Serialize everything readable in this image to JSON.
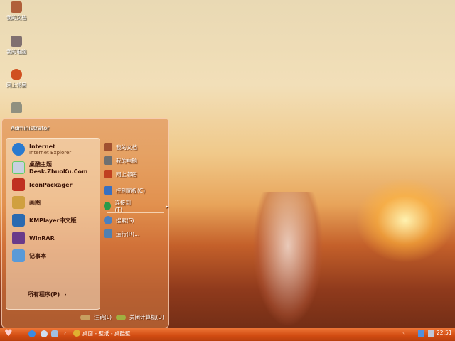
{
  "desktop": {
    "icons": [
      {
        "label": "我的文档",
        "icon": "my-documents-icon",
        "color": "#b0603a"
      },
      {
        "label": "我的电脑",
        "icon": "my-computer-icon",
        "color": "#807070"
      },
      {
        "label": "网上邻居",
        "icon": "network-icon",
        "color": "#d05020"
      },
      {
        "label": "",
        "icon": "recycle-bin-icon",
        "color": "#909080"
      }
    ]
  },
  "start_menu": {
    "user": "Administrator",
    "left_items": [
      {
        "title": "Internet",
        "subtitle": "Internet Explorer",
        "icon": "ie-icon",
        "color": "#2a7ad0"
      },
      {
        "title": "桌酷主题",
        "subtitle": "Desk.ZhuoKu.Com",
        "icon": "zhuoku-icon",
        "color": "#c8d0e0"
      },
      {
        "title": "IconPackager",
        "subtitle": "",
        "icon": "iconpackager-icon",
        "color": "#c03020"
      },
      {
        "title": "画图",
        "subtitle": "",
        "icon": "paint-icon",
        "color": "#d0a040"
      },
      {
        "title": "KMPlayer中文版",
        "subtitle": "",
        "icon": "kmplayer-icon",
        "color": "#2a6ab0"
      },
      {
        "title": "WinRAR",
        "subtitle": "",
        "icon": "winrar-icon",
        "color": "#6a3a8a"
      },
      {
        "title": "记事本",
        "subtitle": "",
        "icon": "notepad-icon",
        "color": "#5a9ad8"
      }
    ],
    "all_programs": "所有程序(P)",
    "right_items": [
      {
        "label": "我的文档",
        "icon": "my-documents-icon",
        "color": "#a05030"
      },
      {
        "label": "我的电脑",
        "icon": "my-computer-icon",
        "color": "#707070"
      },
      {
        "label": "网上邻居",
        "icon": "network-icon",
        "color": "#c04020"
      },
      {
        "label": "控制面板(C)",
        "icon": "control-panel-icon",
        "color": "#3a70c0"
      },
      {
        "label": "连接到(T)",
        "icon": "connect-icon",
        "color": "#2a9a4a"
      },
      {
        "label": "搜索(S)",
        "icon": "search-icon",
        "color": "#4a80c0"
      },
      {
        "label": "运行(R)...",
        "icon": "run-icon",
        "color": "#5080b0"
      }
    ],
    "logoff": "注销(L)",
    "shutdown": "关闭计算机(U)"
  },
  "taskbar": {
    "task": "桌面 - 壁纸 - 桌酷壁...",
    "clock": "22:51",
    "accent": "#d24c12"
  }
}
